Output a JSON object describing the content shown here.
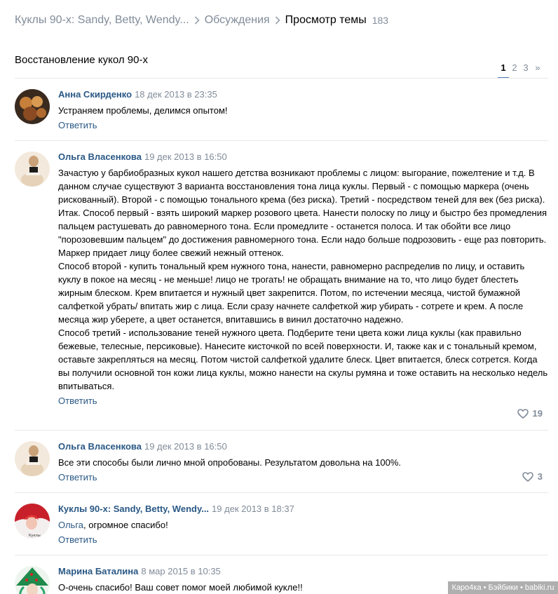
{
  "breadcrumb": {
    "group": "Куклы 90-х: Sandy, Betty, Wendy...",
    "section": "Обсуждения",
    "current": "Просмотр темы",
    "count": "183"
  },
  "topic": {
    "title": "Восстановление кукол 90-х"
  },
  "pagination": {
    "pages": [
      "1",
      "2",
      "3"
    ],
    "next": "»",
    "current": "1"
  },
  "posts": [
    {
      "author": "Анна Скирденко",
      "date": "18 дек 2013 в 23:35",
      "lines": [
        "Устраняем проблемы, делимся опытом!"
      ],
      "reply": "Ответить"
    },
    {
      "author": "Ольга Власенкова",
      "date": "19 дек 2013 в 16:50",
      "lines": [
        "Зачастую у барбиобразных кукол нашего детства возникают проблемы с лицом: выгорание, пожелтение и т.д. В данном случае существуют 3 варианта восстановления тона лица куклы. Первый - с помощью маркера (очень рискованный). Второй - с помощью тонального крема (без риска). Третий - посредством теней для век (без риска).",
        "Итак. Способ первый - взять широкий маркер розового цвета. Нанести полоску по лицу и быстро без промедления пальцем растушевать до равномерного тона. Если промедлите - останется полоса. И так обойти все лицо \"порозовевшим пальцем\" до достижения равномерного тона. Если надо больше подрозовить - еще раз повторить. Маркер придает лицу более свежий нежный оттенок.",
        "Способ второй - купить тональный крем нужного тона, нанести, равномерно распределив по лицу, и оставить куклу в покое на месяц - не меньше! лицо не трогать! не обращать внимание на то, что лицо будет блестеть жирным блеском. Крем впитается и нужный цвет закрепится. Потом, по истечении месяца, чистой бумажной салфеткой убрать/ впитать жир с лица. Если сразу начнете салфеткой жир убирать - сотрете и крем. А после месяца жир уберете, а цвет останется, впитавшись в винил достаточно надежно.",
        "Способ третий - использование теней нужного цвета. Подберите тени цвета кожи лица куклы (как правильно бежевые, телесные, персиковые). Нанесите кисточкой по всей поверхности. И, также как и с тональный кремом, оставьте закрепляться на месяц. Потом чистой салфеткой удалите блеск. Цвет впитается, блеск сотрется. Когда вы получили основной тон кожи лица куклы, можно нанести на скулы румяна и тоже оставить на несколько недель впитываться."
      ],
      "reply": "Ответить",
      "likes": "19"
    },
    {
      "author": "Ольга Власенкова",
      "date": "19 дек 2013 в 16:50",
      "lines": [
        "Все эти способы были лично мной опробованы. Результатом довольна на 100%."
      ],
      "reply": "Ответить",
      "likes": "3"
    },
    {
      "author": "Куклы 90-х: Sandy, Betty, Wendy...",
      "date": "19 дек 2013 в 18:37",
      "reply_to": "Ольга",
      "text_after": ", огромное спасибо!",
      "avatar_caption": "Куклы",
      "reply": "Ответить"
    },
    {
      "author": "Марина Баталина",
      "date": "8 мар 2015 в 10:35",
      "lines": [
        "О-очень спасибо! Ваш совет помог моей любимой кукле!!"
      ]
    }
  ],
  "watermark": "Каро4ка • Бэйбики • babiki.ru",
  "colors": {
    "link": "#2a5885",
    "muted": "#818c99",
    "divider": "#e7e8ec",
    "accent": "#5181b8"
  }
}
